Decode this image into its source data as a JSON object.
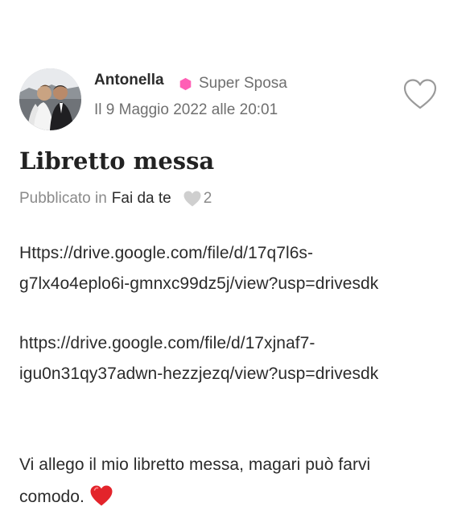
{
  "author": {
    "name": "Antonella",
    "badge": "Super Sposa",
    "badge_color": "#ff5fb5",
    "date": "Il 9 Maggio 2022 alle 20:01"
  },
  "post": {
    "title": "Libretto messa",
    "published_prefix": "Pubblicato in",
    "category": "Fai da te",
    "likes": "2",
    "link1_line1": "Https://drive.google.com/file/d/17q7l6s-",
    "link1_line2": "g7lx4o4eplo6i-gmnxc99dz5j/view?usp=drivesdk",
    "link2_line1": "https://drive.google.com/file/d/17xjnaf7-",
    "link2_line2": "igu0n31qy37adwn-hezzjezq/view?usp=drivesdk",
    "message_line1": "Vi allego il mio libretto messa, magari può farvi",
    "message_line2": "comodo."
  },
  "icons": {
    "avatar": "wedding-couple-photo",
    "badge": "pink-hexagon-icon",
    "like": "heart-outline-icon",
    "likes_count": "heart-filled-grey-icon",
    "emoji": "red-heart-emoji"
  },
  "colors": {
    "text": "#222222",
    "muted": "#8a8a8a",
    "heart_grey": "#cfcfcf",
    "emoji_red": "#e3242b"
  }
}
